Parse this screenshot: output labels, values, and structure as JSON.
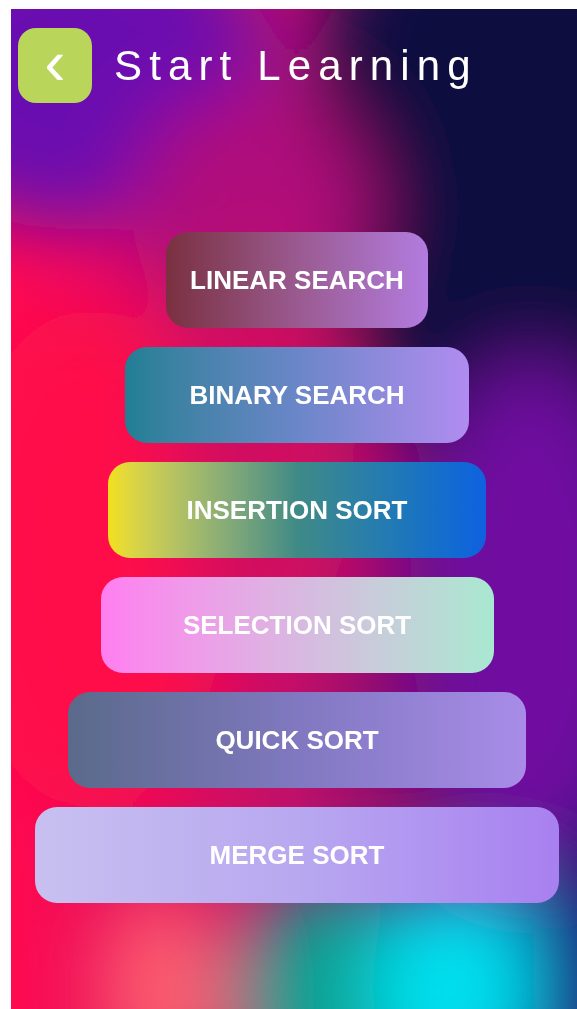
{
  "header": {
    "back_button": {
      "label": "‹"
    },
    "title": "Start Learning"
  },
  "menu": [
    {
      "label": "LINEAR SEARCH"
    },
    {
      "label": "BINARY SEARCH"
    },
    {
      "label": "INSERTION SORT"
    },
    {
      "label": "SELECTION SORT"
    },
    {
      "label": "QUICK SORT"
    },
    {
      "label": "MERGE SORT"
    }
  ]
}
